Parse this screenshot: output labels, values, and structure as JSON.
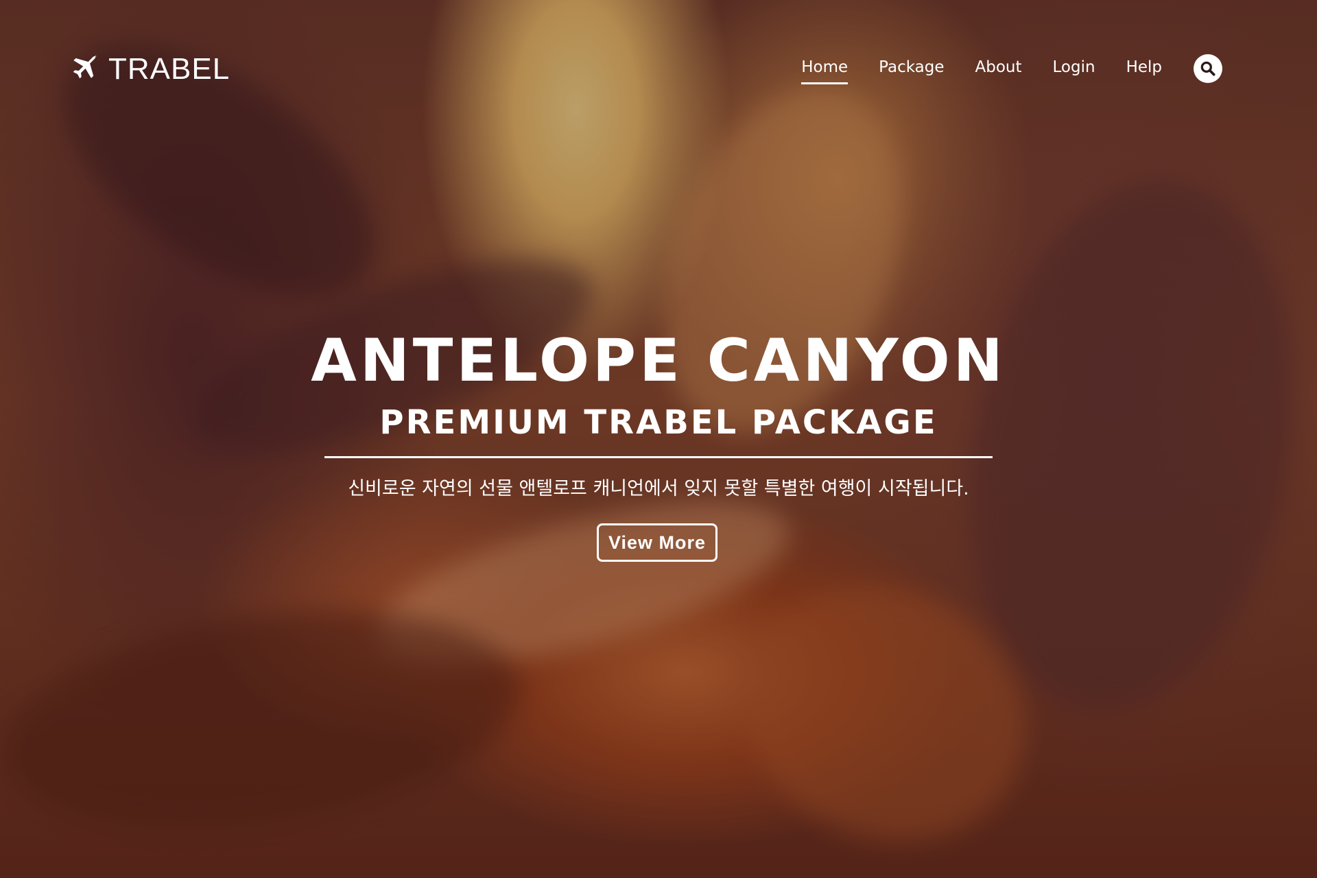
{
  "brand": {
    "logo_icon": "airplane-icon",
    "name": "TRABEL"
  },
  "nav": {
    "items": [
      {
        "label": "Home",
        "active": true
      },
      {
        "label": "Package",
        "active": false
      },
      {
        "label": "About",
        "active": false
      },
      {
        "label": "Login",
        "active": false
      },
      {
        "label": "Help",
        "active": false
      }
    ],
    "search_icon": "search-icon"
  },
  "hero": {
    "title": "ANTELOPE CANYON",
    "subtitle": "PREMIUM TRABEL PACKAGE",
    "tagline": "신비로운 자연의 선물 앤텔로프 캐니언에서 잊지 못할 특별한 여행이 시작됩니다.",
    "button_label": "View More",
    "background": "canyon-photo"
  },
  "colors": {
    "text": "#ffffff",
    "overlay": "#1e0c0a"
  }
}
